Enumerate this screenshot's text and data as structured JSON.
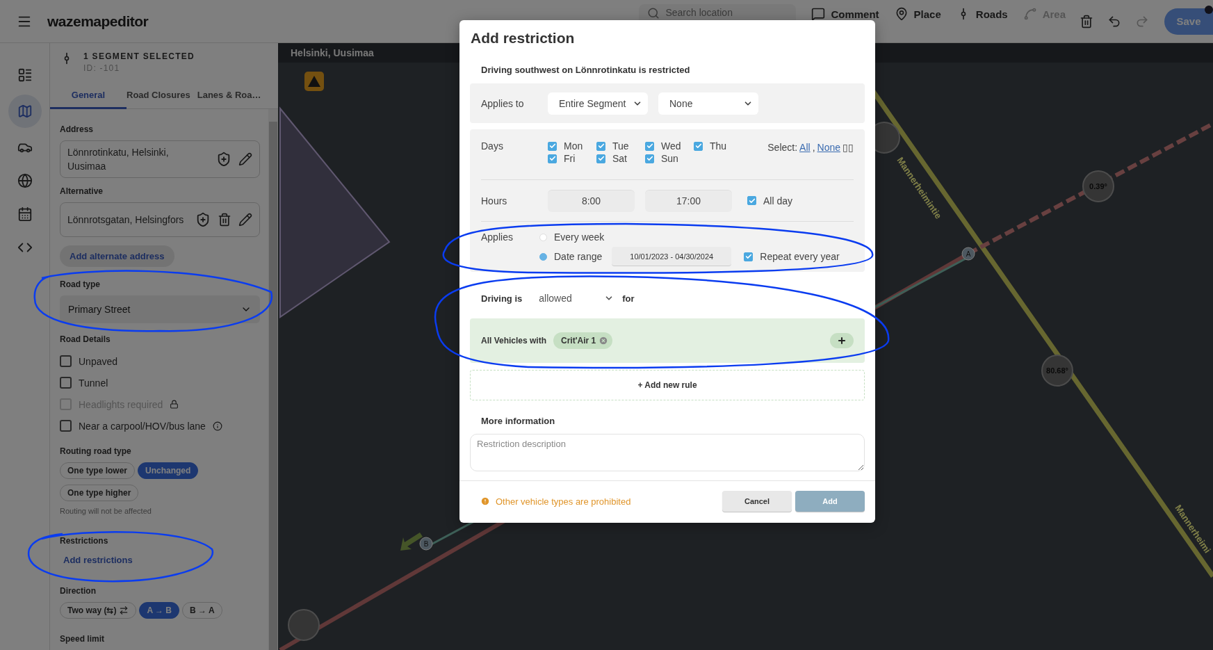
{
  "topbar": {
    "logo": "wazemapeditor",
    "search": {
      "placeholder": "Search location"
    },
    "tools": [
      {
        "kind": "comment",
        "label": "Comment",
        "disabled": false
      },
      {
        "kind": "place",
        "label": "Place",
        "disabled": false
      },
      {
        "kind": "roads",
        "label": "Roads",
        "disabled": false
      },
      {
        "kind": "area",
        "label": "Area",
        "disabled": true
      }
    ],
    "save": "Save"
  },
  "rail": [
    {
      "kind": "list",
      "selected": false
    },
    {
      "kind": "map",
      "selected": true
    },
    {
      "kind": "car",
      "selected": false
    },
    {
      "kind": "globe",
      "selected": false
    },
    {
      "kind": "calendar",
      "selected": false
    },
    {
      "kind": "code",
      "selected": false
    }
  ],
  "panel": {
    "title": "1 SEGMENT SELECTED",
    "id": "ID: -101",
    "tabs": [
      {
        "label": "General",
        "selected": true
      },
      {
        "label": "Road Closures",
        "selected": false
      },
      {
        "label": "Lanes & Roa…",
        "selected": false
      }
    ],
    "address": {
      "label": "Address",
      "value": "Lönnrotinkatu, Helsinki, Uusimaa"
    },
    "alternative": {
      "label": "Alternative",
      "value": "Lönnrotsgatan, Helsingfors"
    },
    "add_alternate": "Add alternate address",
    "road_type": {
      "label": "Road type",
      "value": "Primary Street"
    },
    "road_details": {
      "label": "Road Details",
      "items": [
        {
          "kind": "plain",
          "label": "Unpaved",
          "checked": false,
          "disabled": false
        },
        {
          "kind": "plain",
          "label": "Tunnel",
          "checked": false,
          "disabled": false
        },
        {
          "kind": "locked",
          "label": "Headlights required",
          "checked": false,
          "disabled": true
        },
        {
          "kind": "info",
          "label": "Near a carpool/HOV/bus lane",
          "checked": false,
          "disabled": false
        }
      ]
    },
    "routing": {
      "label": "Routing road type",
      "options": [
        {
          "label": "One type lower",
          "selected": false
        },
        {
          "label": "Unchanged",
          "selected": true
        },
        {
          "label": "One type higher",
          "selected": false
        }
      ],
      "note": "Routing will not be affected"
    },
    "restrictions": {
      "label": "Restrictions",
      "link": "Add restrictions"
    },
    "direction": {
      "label": "Direction",
      "options": [
        {
          "kind": "two_way",
          "label": "Two way (⇆)",
          "selected": false
        },
        {
          "kind": "plain",
          "label": "A → B",
          "selected": true
        },
        {
          "kind": "plain",
          "label": "B → A",
          "selected": false
        }
      ]
    },
    "speed_limit": {
      "label": "Speed limit"
    }
  },
  "map": {
    "location": "Helsinki, Uusimaa",
    "angles": [
      "0.39°",
      "80.68°"
    ],
    "street_labels": [
      "Mannerheimintie",
      "Mannerheimi"
    ],
    "nodes": [
      "A",
      "B"
    ]
  },
  "dialog": {
    "title": "Add restriction",
    "subtitle": "Driving southwest on Lönnrotinkatu is restricted",
    "applies_to": {
      "label": "Applies to",
      "selects": [
        "Entire Segment",
        "None"
      ]
    },
    "days": {
      "label": "Days",
      "items": [
        {
          "label": "Mon",
          "checked": true
        },
        {
          "label": "Tue",
          "checked": true
        },
        {
          "label": "Wed",
          "checked": true
        },
        {
          "label": "Thu",
          "checked": true
        },
        {
          "label": "Fri",
          "checked": true
        },
        {
          "label": "Sat",
          "checked": true
        },
        {
          "label": "Sun",
          "checked": true
        }
      ],
      "select_label": "Select:",
      "links": [
        "All",
        "None"
      ],
      "separator": ",",
      "tail": "▯▯"
    },
    "hours": {
      "label": "Hours",
      "from": "8:00",
      "to": "17:00",
      "all_day": {
        "label": "All day",
        "checked": true
      }
    },
    "applies": {
      "label": "Applies",
      "options": [
        {
          "label": "Every week",
          "selected": false
        },
        {
          "label": "Date range",
          "selected": true
        }
      ],
      "date_range": "10/01/2023 - 04/30/2024",
      "repeat": {
        "label": "Repeat every year",
        "checked": true
      }
    },
    "driving": {
      "label": "Driving is",
      "value": "allowed",
      "suffix": "for"
    },
    "rule": {
      "label": "All Vehicles with",
      "chips": [
        "Crit'Air 1"
      ]
    },
    "add_rule": "+ Add new rule",
    "more_info": {
      "label": "More information",
      "placeholder": "Restriction description"
    },
    "warning": "Other vehicle types are prohibited",
    "buttons": [
      {
        "kind": "secondary",
        "label": "Cancel"
      },
      {
        "kind": "primary",
        "label": "Add"
      }
    ]
  }
}
